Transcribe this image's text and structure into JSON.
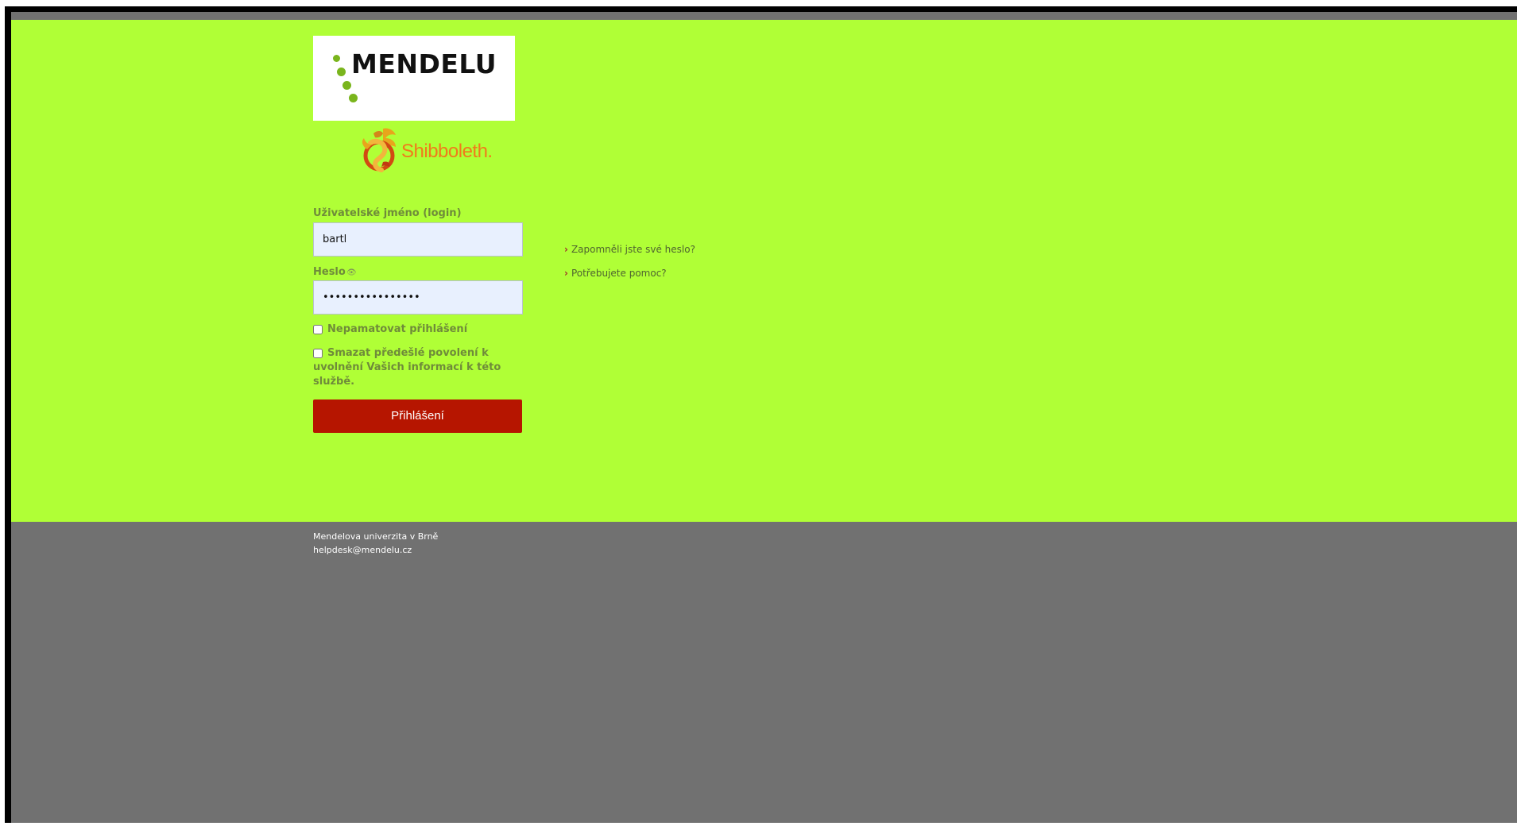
{
  "branding": {
    "university_logo_text": "MENDELU",
    "shibboleth_logo_text": "Shibboleth."
  },
  "form": {
    "username_label": "Uživatelské jméno (login)",
    "username_value": "bartl",
    "password_label": "Heslo",
    "password_value": "••••••••••••••••",
    "remember_label": "Nepamatovat přihlášení",
    "consent_line1": "Smazat předešlé povolení k",
    "consent_line2": "uvolnění Vašich informací k této",
    "consent_line3": "službě.",
    "submit_label": "Přihlášení"
  },
  "help_links": {
    "forgot_password": "Zapomněli jste své heslo?",
    "need_help": "Potřebujete pomoc?"
  },
  "footer": {
    "organization": "Mendelova univerzita v Brně",
    "email": "helpdesk@mendelu.cz"
  },
  "colors": {
    "page_background": "#b0ff36",
    "footer_background": "#717171",
    "button_background": "#b61500",
    "shibboleth_orange": "#f07b1b"
  }
}
